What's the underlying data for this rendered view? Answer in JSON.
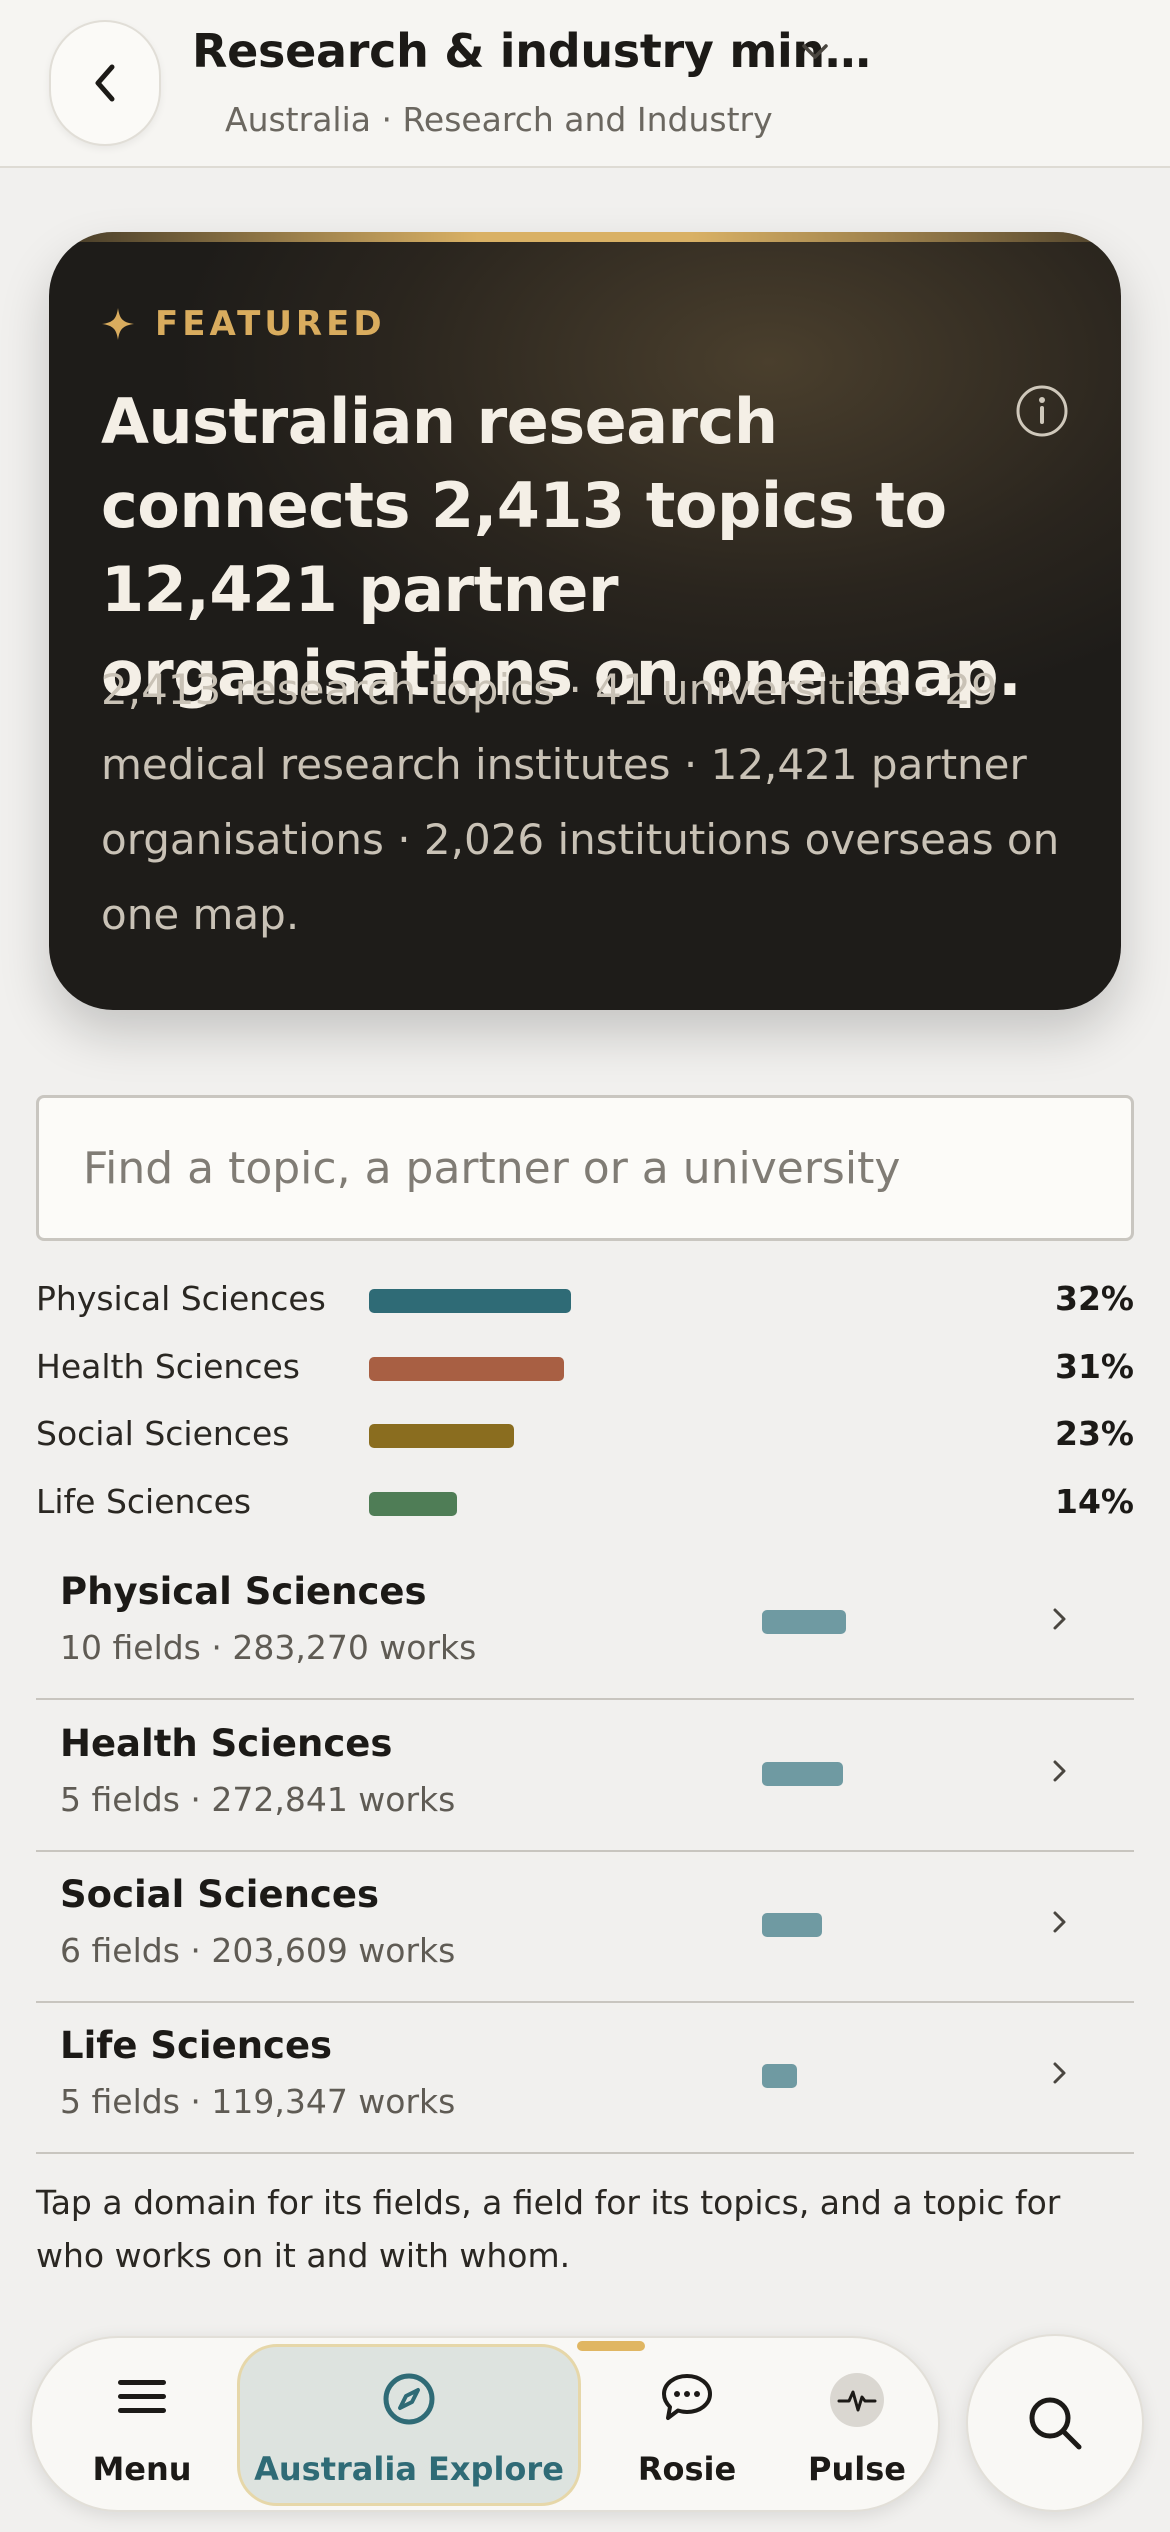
{
  "header": {
    "title": "Research & industry min…",
    "subtitle": "Australia · Research and Industry"
  },
  "featured": {
    "label": "FEATURED",
    "headline": "Australian research connects 2,413 topics to 12,421 partner organisations on one map.",
    "body": "2,413 research topics · 41 universities · 29 medical research institutes · 12,421 partner organisations · 2,026 institutions overseas on one map."
  },
  "search": {
    "placeholder": "Find a topic, a partner or a university",
    "value": ""
  },
  "share_bars": [
    {
      "name": "Physical Sciences",
      "share": 32,
      "pct": "32%",
      "color": "#2f6b76"
    },
    {
      "name": "Health Sciences",
      "share": 31,
      "pct": "31%",
      "color": "#a85f43"
    },
    {
      "name": "Social Sciences",
      "share": 23,
      "pct": "23%",
      "color": "#8a6d1f"
    },
    {
      "name": "Life Sciences",
      "share": 14,
      "pct": "14%",
      "color": "#4f7d56"
    }
  ],
  "domains": [
    {
      "name": "Physical Sciences",
      "meta": "10 fields · 283,270 works",
      "works": 283270
    },
    {
      "name": "Health Sciences",
      "meta": "5 fields · 272,841 works",
      "works": 272841
    },
    {
      "name": "Social Sciences",
      "meta": "6 fields · 203,609 works",
      "works": 203609
    },
    {
      "name": "Life Sciences",
      "meta": "5 fields · 119,347 works",
      "works": 119347
    }
  ],
  "footnote": "Tap a domain for its fields, a field for its topics, and a topic for who works on it and with whom.",
  "nav": {
    "menu": "Menu",
    "explore": "Australia Explore",
    "rosie": "Rosie",
    "pulse": "Pulse",
    "active": "explore"
  },
  "colors": {
    "accent_gold": "#d9ac5e",
    "explore_icon": "#2f6b76",
    "domain_bar": "#6f9aa2"
  }
}
